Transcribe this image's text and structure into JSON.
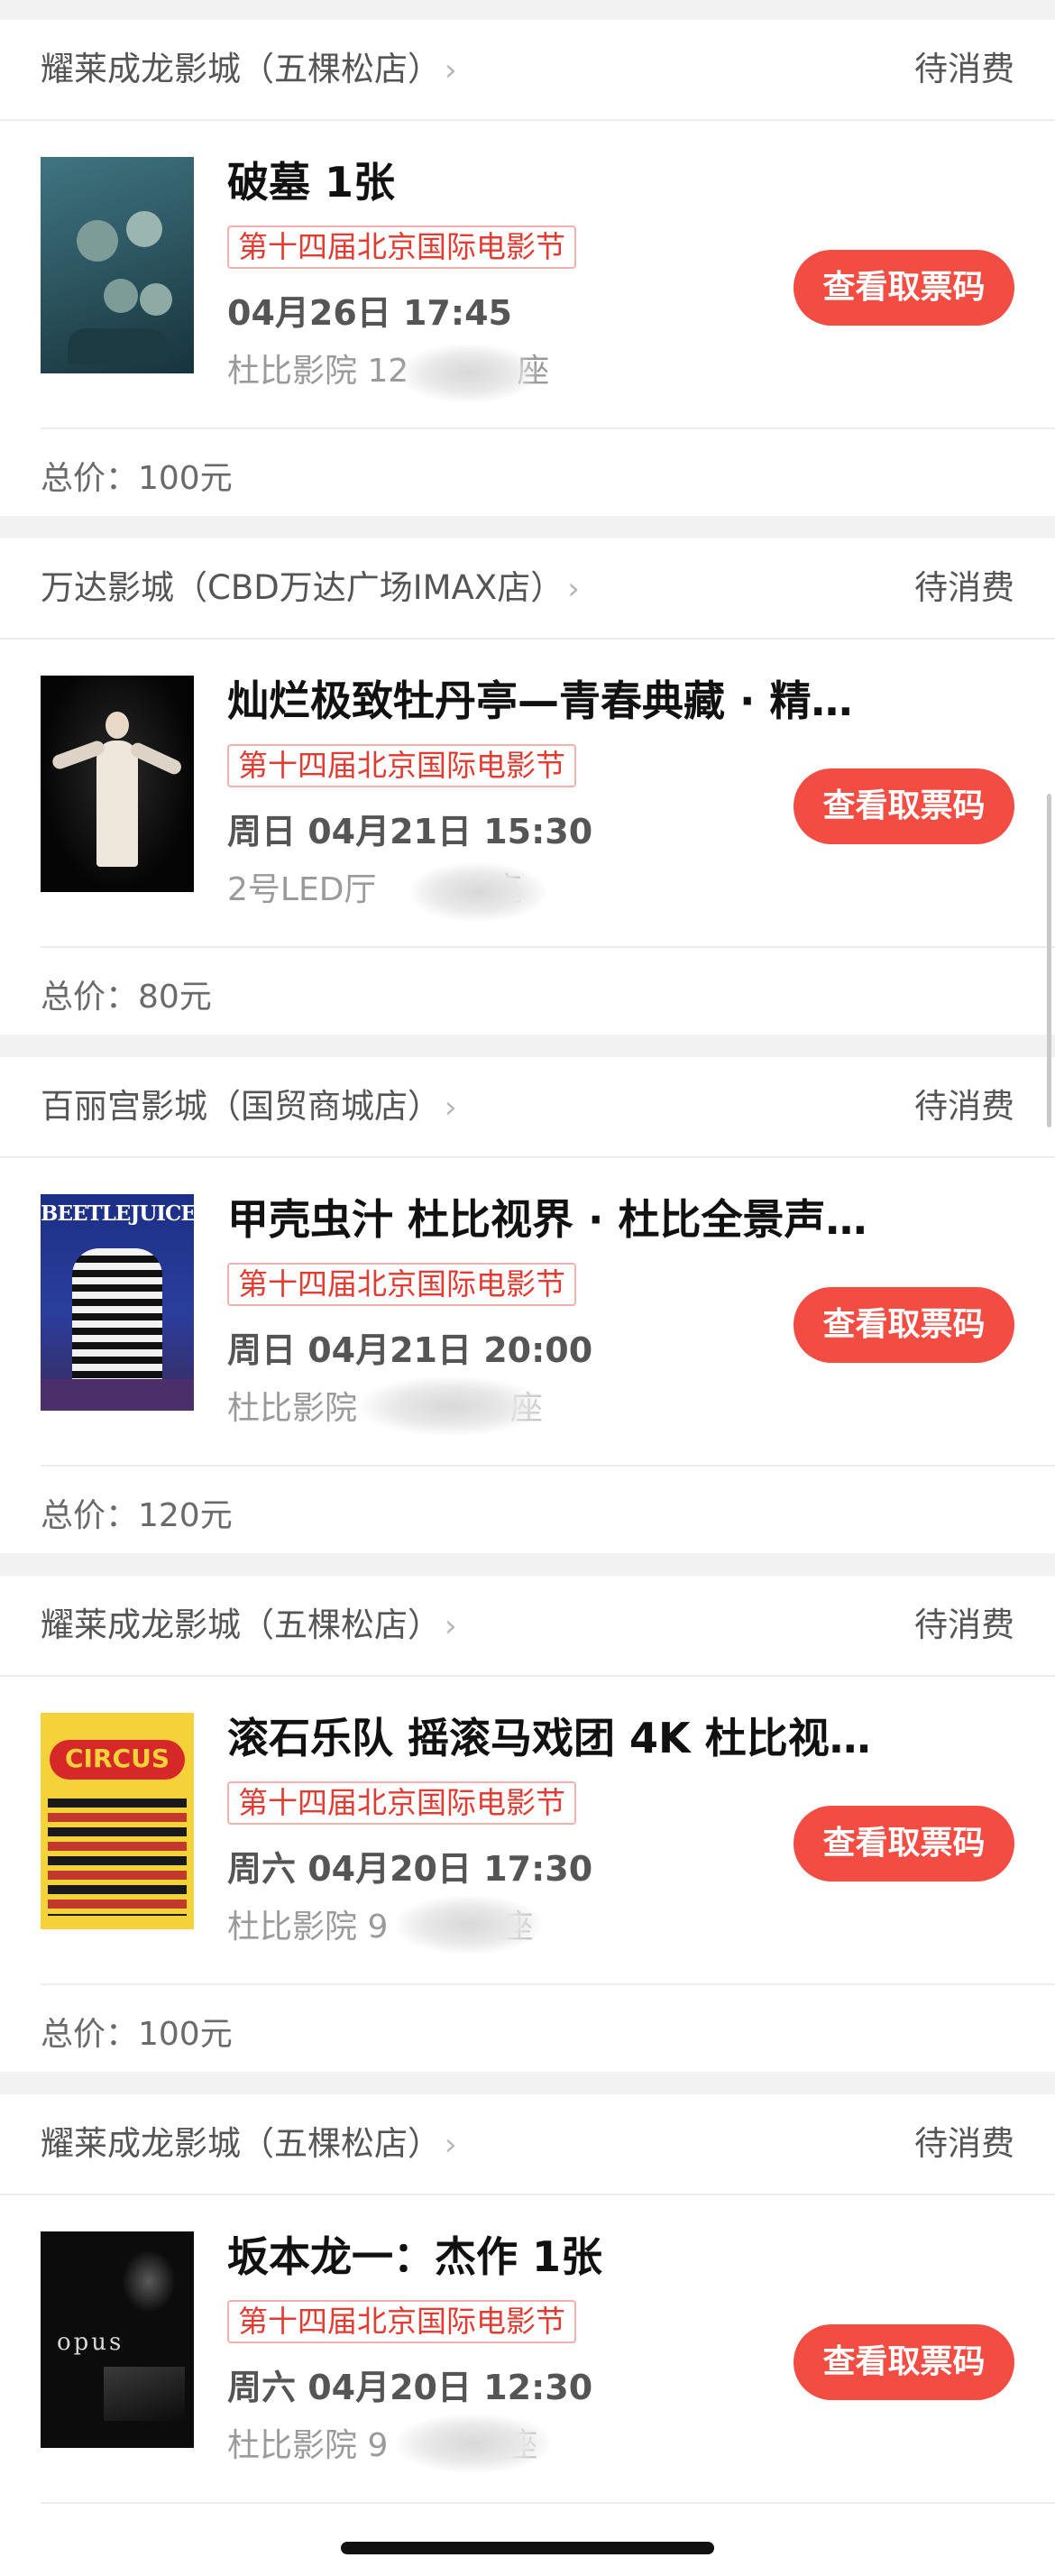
{
  "status_label": "待消费",
  "button_label": "查看取票码",
  "orders": [
    {
      "cinema": "耀莱成龙影城（五棵松店）",
      "title": "破墓 1张",
      "festival": "第十四届北京国际电影节",
      "showtime": "04月26日 17:45",
      "hall": "杜比影院 12",
      "hall_suffix": "座",
      "total": "总价：100元"
    },
    {
      "cinema": "万达影城（CBD万达广场IMAX店）",
      "title": "灿烂极致牡丹亭—青春典藏 · 精…",
      "festival": "第十四届北京国际电影节",
      "showtime": "周日 04月21日 15:30",
      "hall": "2号LED厅",
      "hall_suffix": "座",
      "total": "总价：80元"
    },
    {
      "cinema": "百丽宫影城（国贸商城店）",
      "title": "甲壳虫汁 杜比视界 · 杜比全景声…",
      "festival": "第十四届北京国际电影节",
      "showtime": "周日 04月21日 20:00",
      "hall": "杜比影院",
      "hall_suffix": "座",
      "total": "总价：120元"
    },
    {
      "cinema": "耀莱成龙影城（五棵松店）",
      "title": "滚石乐队 摇滚马戏团 4K 杜比视…",
      "festival": "第十四届北京国际电影节",
      "showtime": "周六 04月20日 17:30",
      "hall": "杜比影院 9",
      "hall_suffix": "座",
      "total": "总价：100元"
    },
    {
      "cinema": "耀莱成龙影城（五棵松店）",
      "title": "坂本龙一：杰作 1张",
      "festival": "第十四届北京国际电影节",
      "showtime": "周六 04月20日 12:30",
      "hall": "杜比影院 9",
      "hall_suffix": "座"
    }
  ],
  "posters": {
    "p3_text": "BEETLEJUICE",
    "p4_text": "CIRCUS",
    "p5_text": "opus"
  },
  "colors": {
    "accent": "#f24c43",
    "tag_text": "#e23b32",
    "background": "#f2f2f2"
  }
}
